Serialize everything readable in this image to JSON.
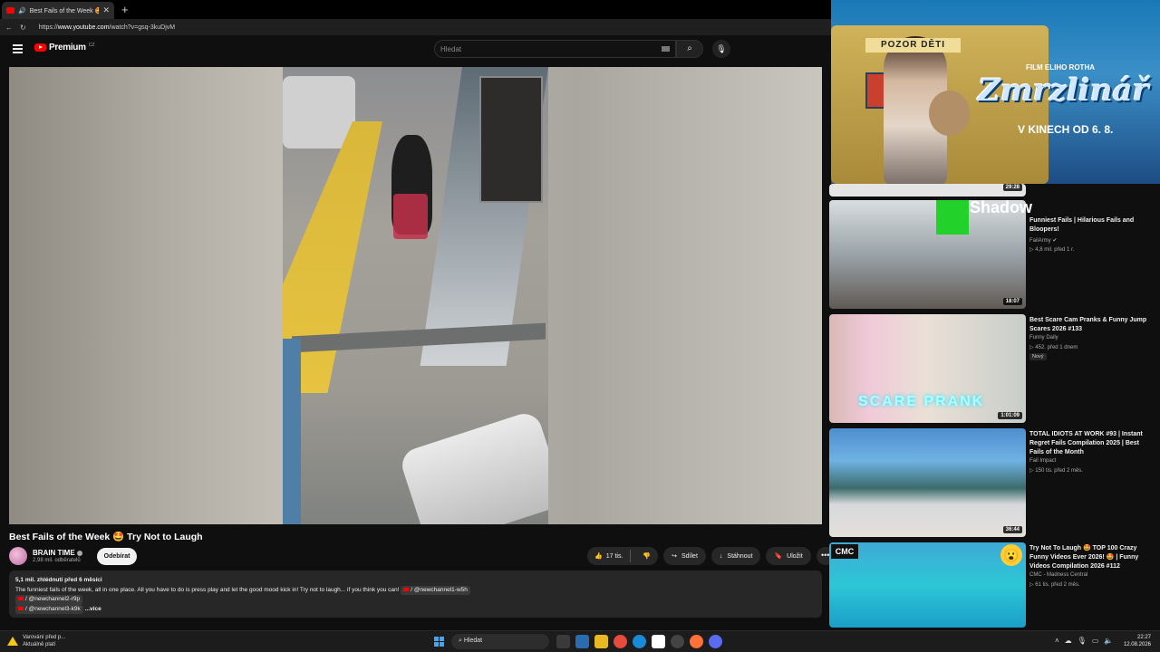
{
  "browser": {
    "tab_title": "Best Fails of the Week 🤩 Try",
    "tab_close": "✕",
    "new_tab": "+",
    "url_prefix": "https://",
    "url_host": "www.youtube.com",
    "url_path": "/watch?v=gsq-3kuDjvM"
  },
  "header": {
    "logo_text": "Premium",
    "region": "CZ",
    "search_placeholder": "Hledat"
  },
  "video": {
    "title": "Best Fails of the Week 🤩 Try Not to Laugh",
    "channel_name": "BRAIN TIME",
    "subscribers": "2,98 mil. odběratelů",
    "subscribe_label": "Odebírat",
    "likes": "17 tis.",
    "share_label": "Sdílet",
    "download_label": "Stáhnout",
    "save_label": "Uložit",
    "more_label": "•••"
  },
  "description": {
    "meta": "5,1 mil. zhlédnutí  před 6 měsíci",
    "line1": "The funniest fails of the week, all in one place. All you have to do is press play and let the good mood kick in! Try not to laugh... if you think you can!",
    "chip1": "/ @newchannel1-w5h",
    "chip2": "/ @newchannel2-r9p",
    "chip3": "/ @newchannel3-k9k",
    "more": "...více"
  },
  "ad": {
    "sign": "POZOR DĚTI",
    "film": "FILM ELIHO ROTHA",
    "brand": "Zmrzlinář",
    "date": "V KINECH OD 6. 8."
  },
  "related": [
    {
      "title": "",
      "channel": "",
      "stats": "",
      "duration": "29:28",
      "overlay": "Shadow"
    },
    {
      "title": "Funniest Fails | Hilarious Fails and Bloopers!",
      "channel": "FailArmy",
      "stats": "▷ 4,8 mil.  před 1 r.",
      "duration": "18:07"
    },
    {
      "title": "Best Scare Cam Pranks & Funny Jump Scares 2026 #133",
      "channel": "Funny Daily",
      "stats": "▷ 452.  před 1 dnem",
      "badge": "Nový",
      "duration": "1:01:09",
      "overlay": "SCARE PRANK"
    },
    {
      "title": "TOTAL IDIOTS AT WORK #93 | Instant Regret Fails Compilation 2025 | Best Fails of the Month",
      "channel": "Fail Impact",
      "stats": "▷ 150 tis.  před 2 měs.",
      "duration": "36:44"
    },
    {
      "title": "Try Not To Laugh 🤩 TOP 100 Crazy Funny Videos Ever 2026! 🤩 | Funny Videos Compilation 2026 #112",
      "channel": "CMC - Madness Central",
      "stats": "▷ 61 tis.  před 2 měs.",
      "overlay": "CMC"
    }
  ],
  "taskbar": {
    "warning_line1": "Varování před p...",
    "warning_line2": "Aktuálně platí",
    "search": "Hledat",
    "time": "22:27",
    "date": "12.08.2026"
  }
}
